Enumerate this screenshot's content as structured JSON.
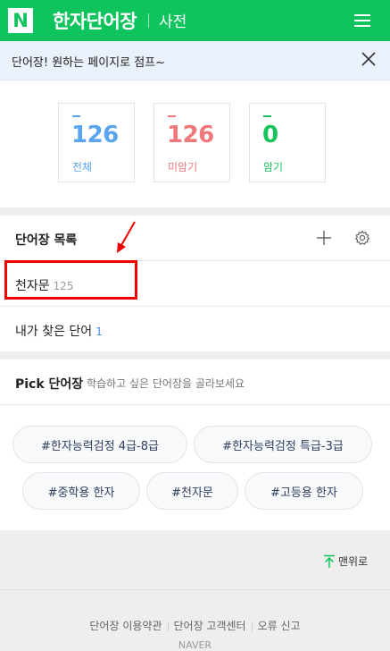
{
  "header": {
    "logo_letter": "N",
    "title": "한자단어장",
    "subtitle": "사전",
    "brand_color": "#0fc35d"
  },
  "notice": {
    "text": "단어장! 원하는 페이지로 점프~"
  },
  "stats": [
    {
      "value": "126",
      "label": "전체",
      "color": "#5aa5f0"
    },
    {
      "value": "126",
      "label": "미암기",
      "color": "#f0787a"
    },
    {
      "value": "0",
      "label": "암기",
      "color": "#17c35a"
    }
  ],
  "wordbooks": {
    "title": "단어장 목록",
    "items": [
      {
        "name": "천자문",
        "count": "125"
      },
      {
        "name": "내가 찾은 단어",
        "count": "1"
      }
    ]
  },
  "pick": {
    "title": "Pick 단어장",
    "description": "학습하고 싶은 단어장을 골라보세요",
    "tags": [
      "#한자능력검정 4급-8급",
      "#한자능력검정 특급-3급",
      "#중학용 한자",
      "#천자문",
      "#고등용 한자"
    ]
  },
  "footer": {
    "totop_label": "맨위로",
    "links": [
      "단어장 이용약관",
      "단어장 고객센터",
      "오류 신고"
    ],
    "copyright": "NAVER"
  },
  "annotation_color": "#f00000"
}
